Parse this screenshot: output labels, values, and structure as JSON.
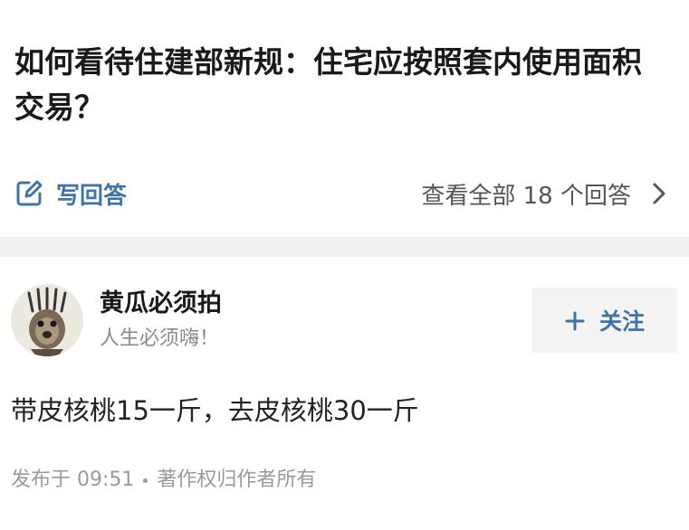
{
  "question": {
    "title": "如何看待住建部新规：住宅应按照套内使用面积交易？"
  },
  "actions": {
    "write_answer_label": "写回答",
    "write_answer_icon": "edit-icon",
    "view_all_label": "查看全部 18 个回答",
    "view_all_icon": "chevron-right-icon"
  },
  "answer": {
    "author_name": "黄瓜必须拍",
    "author_bio": "人生必须嗨！",
    "avatar_icon": "avatar-image",
    "follow_label": "关注",
    "follow_icon": "plus-icon",
    "content": "带皮核桃15一斤，去皮核桃30一斤",
    "published": "发布于 09:51",
    "copyright": "著作权归作者所有"
  },
  "colors": {
    "accent": "#3f74a8",
    "separator": "#f0f0f0",
    "muted_text": "#9a9a9a"
  }
}
